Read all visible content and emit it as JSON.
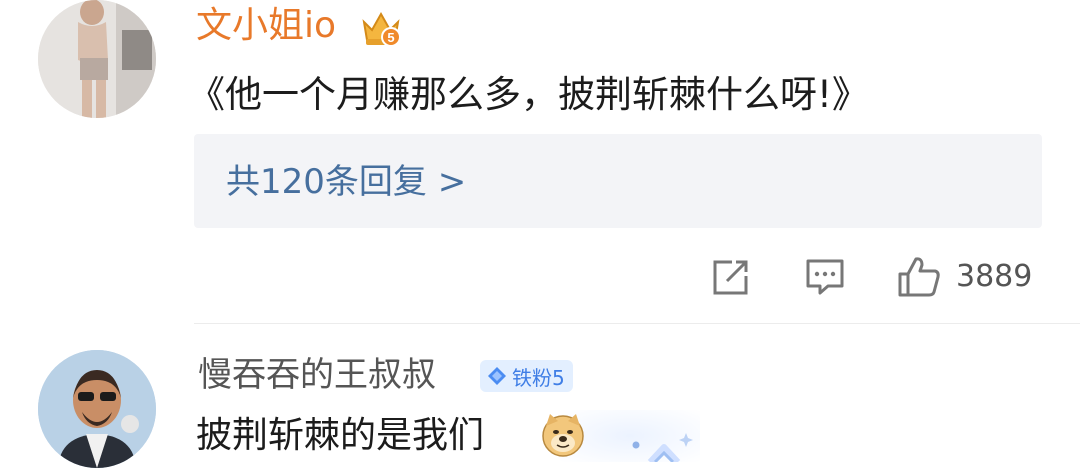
{
  "comments": [
    {
      "username": "文小姐io",
      "badge_icon": "crown-level-badge",
      "badge_level": "5",
      "text": "《他一个月赚那么多，披荆斩棘什么呀!》",
      "replies_link": "共120条回复 >",
      "actions": {
        "share_icon": "share-icon",
        "comment_icon": "comment-icon",
        "like_icon": "thumbs-up-icon",
        "like_count": "3889"
      }
    },
    {
      "username": "慢吞吞的王叔叔",
      "fan_badge": "铁粉5",
      "fan_badge_icon": "diamond-icon",
      "text": "披荆斩棘的是我们",
      "emoji": "doge-emoji"
    }
  ],
  "colors": {
    "username_vip": "#e8792a",
    "username_normal": "#555555",
    "link": "#466f9e",
    "reply_box_bg": "#f3f4f7",
    "fan_badge_text": "#3f7ee6",
    "fan_badge_bg": "#e3efff"
  }
}
